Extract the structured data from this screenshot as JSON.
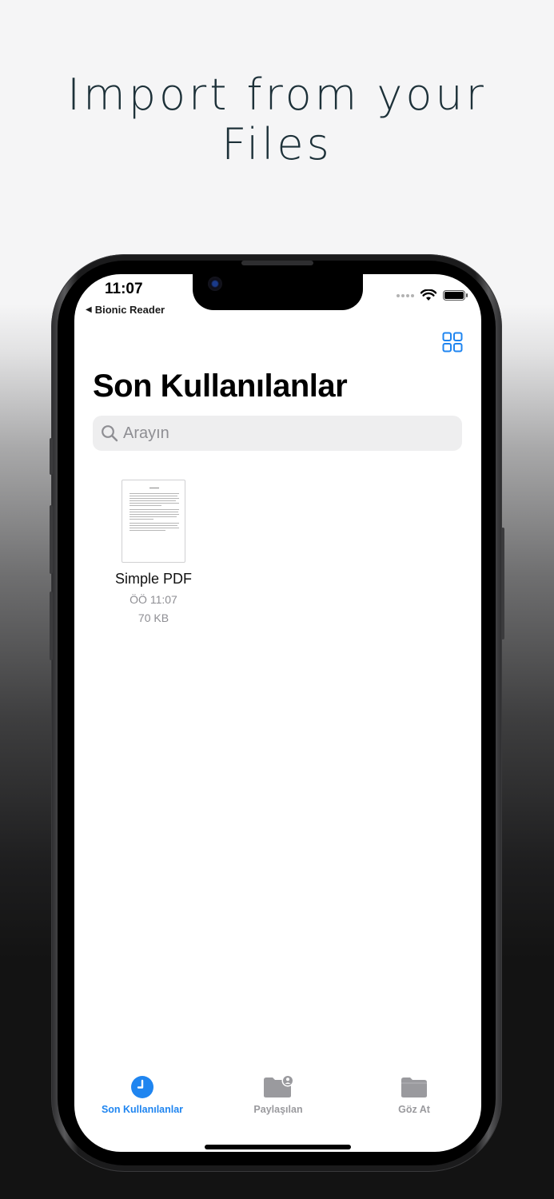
{
  "headline": {
    "line1": "Import from your",
    "line2": "Files"
  },
  "status_bar": {
    "time": "11:07",
    "back_app": "Bionic Reader",
    "back_glyph": "◀"
  },
  "page": {
    "title": "Son Kullanılanlar"
  },
  "search": {
    "placeholder": "Arayın"
  },
  "files": [
    {
      "name": "Simple PDF",
      "date": "ÖÖ 11:07",
      "size": "70 KB"
    }
  ],
  "tabs": [
    {
      "label": "Son Kullanılanlar",
      "icon": "clock-icon",
      "active": true
    },
    {
      "label": "Paylaşılan",
      "icon": "shared-folder-icon",
      "active": false
    },
    {
      "label": "Göz At",
      "icon": "folder-icon",
      "active": false
    }
  ],
  "colors": {
    "accent": "#1f85f0",
    "headline": "#1d3139",
    "inactive_tab": "#9a9a9e"
  }
}
